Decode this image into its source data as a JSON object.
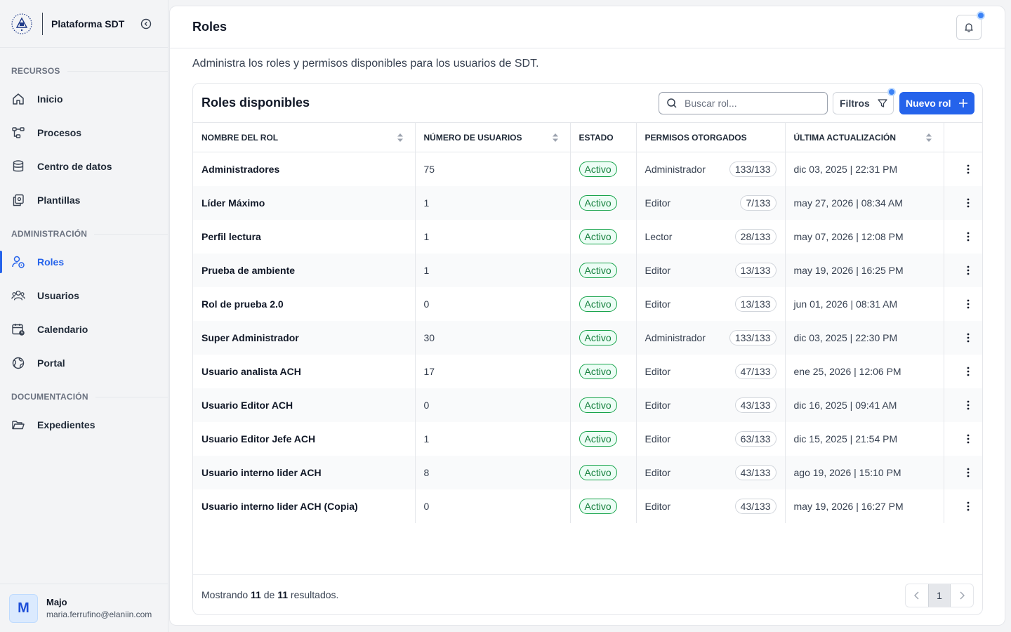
{
  "app": {
    "name": "Plataforma SDT"
  },
  "sidebar": {
    "sections": [
      {
        "label": "RECURSOS"
      },
      {
        "label": "ADMINISTRACIÓN"
      },
      {
        "label": "DOCUMENTACIÓN"
      }
    ],
    "items": [
      {
        "label": "Inicio",
        "icon": "home-icon"
      },
      {
        "label": "Procesos",
        "icon": "workflow-icon"
      },
      {
        "label": "Centro de datos",
        "icon": "database-icon"
      },
      {
        "label": "Plantillas",
        "icon": "templates-icon"
      },
      {
        "label": "Roles",
        "icon": "user-shield-icon",
        "active": true
      },
      {
        "label": "Usuarios",
        "icon": "users-icon"
      },
      {
        "label": "Calendario",
        "icon": "calendar-icon"
      },
      {
        "label": "Portal",
        "icon": "globe-icon"
      },
      {
        "label": "Expedientes",
        "icon": "folder-icon"
      }
    ]
  },
  "user": {
    "initial": "M",
    "name": "Majo",
    "email": "maria.ferrufino@elaniin.com"
  },
  "header": {
    "title": "Roles"
  },
  "page": {
    "description": "Administra los roles y permisos disponibles para los usuarios de SDT."
  },
  "card": {
    "title": "Roles disponibles",
    "search_placeholder": "Buscar rol...",
    "filters_label": "Filtros",
    "new_label": "Nuevo rol"
  },
  "table": {
    "columns": [
      "NOMBRE DEL ROL",
      "NÚMERO DE USUARIOS",
      "ESTADO",
      "PERMISOS OTORGADOS",
      "ÚLTIMA ACTUALIZACIÓN"
    ],
    "rows": [
      {
        "name": "Administradores",
        "users": "75",
        "status": "Activo",
        "perm": "Administrador",
        "count": "133/133",
        "updated": "dic 03, 2025 | 22:31 PM"
      },
      {
        "name": "Líder Máximo",
        "users": "1",
        "status": "Activo",
        "perm": "Editor",
        "count": "7/133",
        "updated": "may 27, 2026 | 08:34 AM"
      },
      {
        "name": "Perfil lectura",
        "users": "1",
        "status": "Activo",
        "perm": "Lector",
        "count": "28/133",
        "updated": "may 07, 2026 | 12:08 PM"
      },
      {
        "name": "Prueba de ambiente",
        "users": "1",
        "status": "Activo",
        "perm": "Editor",
        "count": "13/133",
        "updated": "may 19, 2026 | 16:25 PM"
      },
      {
        "name": "Rol de prueba 2.0",
        "users": "0",
        "status": "Activo",
        "perm": "Editor",
        "count": "13/133",
        "updated": "jun 01, 2026 | 08:31 AM"
      },
      {
        "name": "Super Administrador",
        "users": "30",
        "status": "Activo",
        "perm": "Administrador",
        "count": "133/133",
        "updated": "dic 03, 2025 | 22:30 PM"
      },
      {
        "name": "Usuario analista ACH",
        "users": "17",
        "status": "Activo",
        "perm": "Editor",
        "count": "47/133",
        "updated": "ene 25, 2026 | 12:06 PM"
      },
      {
        "name": "Usuario Editor ACH",
        "users": "0",
        "status": "Activo",
        "perm": "Editor",
        "count": "43/133",
        "updated": "dic 16, 2025 | 09:41 AM"
      },
      {
        "name": "Usuario Editor Jefe ACH",
        "users": "1",
        "status": "Activo",
        "perm": "Editor",
        "count": "63/133",
        "updated": "dic 15, 2025 | 21:54 PM"
      },
      {
        "name": "Usuario interno lider ACH",
        "users": "8",
        "status": "Activo",
        "perm": "Editor",
        "count": "43/133",
        "updated": "ago 19, 2026 | 15:10 PM"
      },
      {
        "name": "Usuario interno lider ACH (Copia)",
        "users": "0",
        "status": "Activo",
        "perm": "Editor",
        "count": "43/133",
        "updated": "may 19, 2026 | 16:27 PM"
      }
    ]
  },
  "footer": {
    "prefix": "Mostrando",
    "shown": "11",
    "middle": "de",
    "total": "11",
    "suffix": "resultados."
  },
  "pagination": {
    "current": "1"
  },
  "colors": {
    "accent": "#2563eb",
    "success": "#16a34a"
  }
}
